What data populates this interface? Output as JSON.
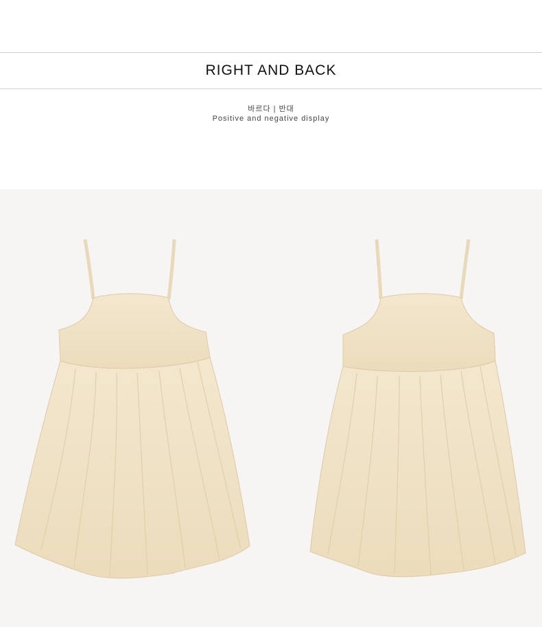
{
  "section": {
    "title": "RIGHT AND BACK",
    "subtitle_ko": "바르다 | 반대",
    "subtitle_en": "Positive and negative display"
  },
  "photos": [
    {
      "name": "front-view",
      "garment": "cream sleeveless sundress",
      "color": "#f1e4c8"
    },
    {
      "name": "back-view",
      "garment": "cream sleeveless sundress",
      "color": "#f1e4c8"
    }
  ],
  "colors": {
    "background": "#ffffff",
    "photo_background": "#f6f5f3",
    "divider": "#cfcfcf",
    "fabric": "#f1e4c8",
    "fabric_shadow": "#e3d2b1"
  }
}
